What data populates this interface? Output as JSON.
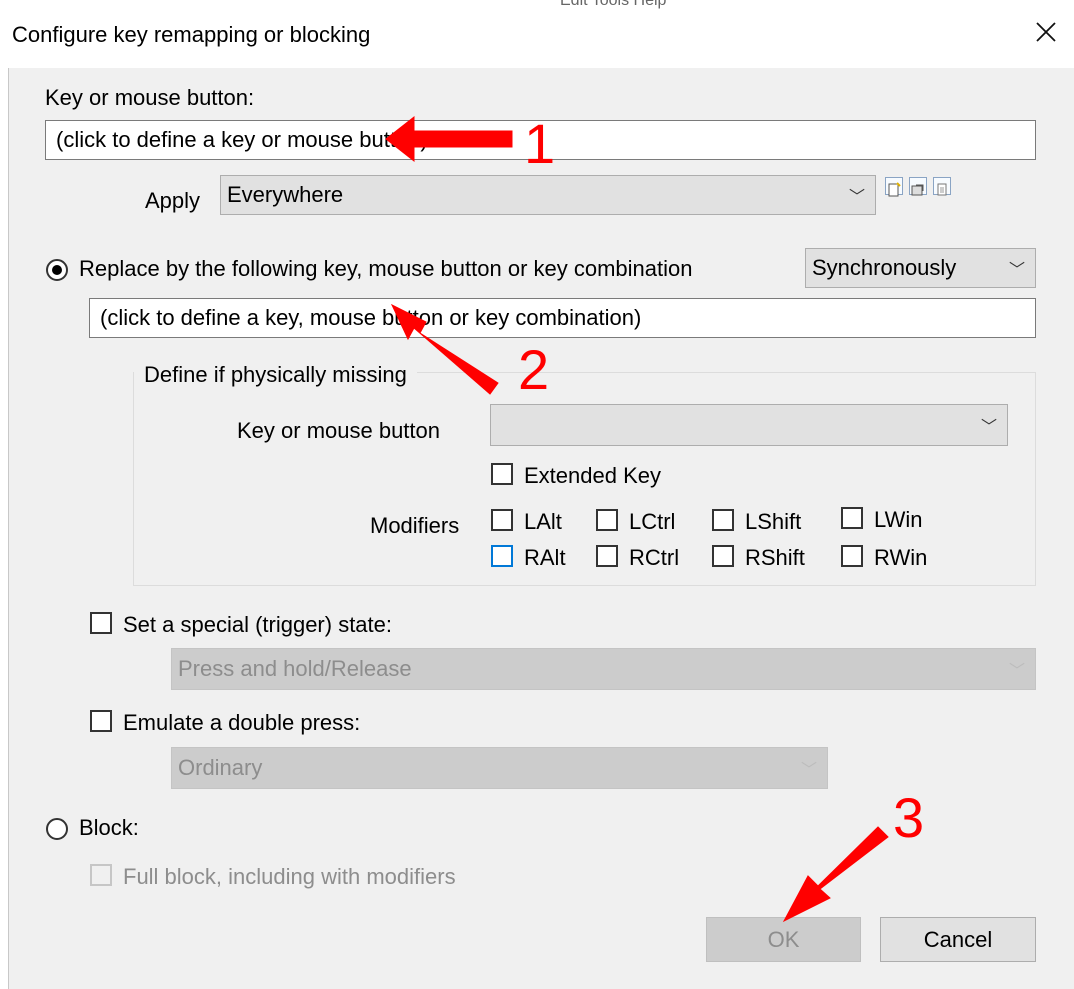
{
  "window": {
    "title": "Configure key remapping or blocking",
    "behind_text": "Edit Tools Help"
  },
  "source": {
    "label": "Key or mouse button:",
    "value": "(click to define a key or mouse button)",
    "apply_label": "Apply",
    "apply_value": "Everywhere",
    "icons": [
      "new-icon",
      "edit-icon",
      "copy-icon"
    ]
  },
  "replace": {
    "label": "Replace by the following key, mouse button or key combination",
    "selected": true,
    "mode_value": "Synchronously",
    "value": "(click to define a key, mouse button or key combination)"
  },
  "missing": {
    "group_label": "Define if physically missing",
    "key_label": "Key or mouse button",
    "key_value": "",
    "extended_label": "Extended Key",
    "modifiers_label": "Modifiers",
    "modifiers": [
      {
        "label": "LAlt",
        "checked": false
      },
      {
        "label": "LCtrl",
        "checked": false
      },
      {
        "label": "LShift",
        "checked": false
      },
      {
        "label": "LWin",
        "checked": false
      },
      {
        "label": "RAlt",
        "checked": false
      },
      {
        "label": "RCtrl",
        "checked": false
      },
      {
        "label": "RShift",
        "checked": false
      },
      {
        "label": "RWin",
        "checked": false
      }
    ]
  },
  "trigger": {
    "label": "Set a special (trigger) state:",
    "checked": false,
    "value": "Press and hold/Release"
  },
  "double_press": {
    "label": "Emulate a double press:",
    "checked": false,
    "value": "Ordinary"
  },
  "block": {
    "label": "Block:",
    "selected": false,
    "full_label": "Full block, including with modifiers"
  },
  "buttons": {
    "ok": "OK",
    "cancel": "Cancel"
  },
  "annotations": {
    "one": "1",
    "two": "2",
    "three": "3",
    "color": "#ff0000"
  },
  "colors": {
    "focus_accent": "#0078d7",
    "dialog_bg": "#f0f0f0"
  }
}
